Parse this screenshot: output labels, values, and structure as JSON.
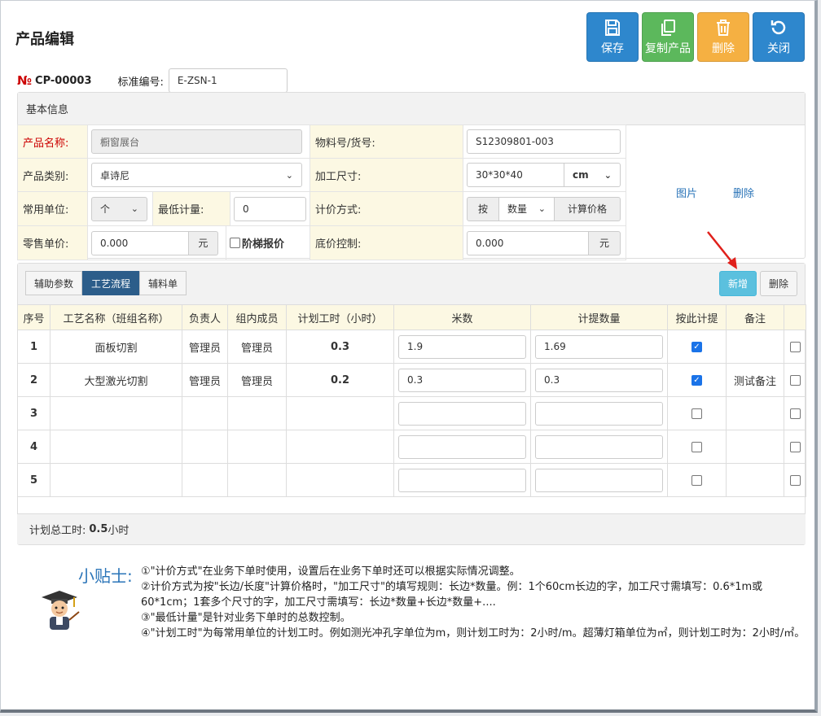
{
  "header": {
    "title": "产品编辑"
  },
  "toolbar": [
    {
      "label": "保存",
      "icon": "save-icon"
    },
    {
      "label": "复制产品",
      "icon": "copy-icon"
    },
    {
      "label": "删除",
      "icon": "trash-icon"
    },
    {
      "label": "关闭",
      "icon": "refresh-icon"
    }
  ],
  "product": {
    "no_mark": "№",
    "code": "CP-00003",
    "std_label": "标准编号:",
    "std_value": "E-ZSN-1"
  },
  "basic": {
    "heading": "基本信息",
    "name_label": "产品名称:",
    "name_value": "橱窗展台",
    "material_label": "物料号/货号:",
    "material_value": "S12309801-003",
    "category_label": "产品类别:",
    "category_value": "卓诗尼",
    "size_label": "加工尺寸:",
    "size_value": "30*30*40",
    "size_unit": "cm",
    "unit_label": "常用单位:",
    "unit_value": "个",
    "min_label": "最低计量:",
    "min_value": "0",
    "pricing_label": "计价方式:",
    "pricing_prefix": "按",
    "pricing_value": "数量",
    "pricing_suffix": "计算价格",
    "retail_label": "零售单价:",
    "retail_value": "0.000",
    "retail_unit": "元",
    "tier_label": "阶梯报价",
    "floor_label": "底价控制:",
    "floor_value": "0.000",
    "floor_unit": "元",
    "image_link": "图片",
    "image_delete": "删除"
  },
  "process": {
    "tabs": [
      "辅助参数",
      "工艺流程",
      "辅料单"
    ],
    "add_button": "新增",
    "delete_button": "删除",
    "columns": [
      "序号",
      "工艺名称（班组名称）",
      "负责人",
      "组内成员",
      "计划工时（小时）",
      "米数",
      "计提数量",
      "按此计提",
      "备注"
    ],
    "rows": [
      {
        "seq": "1",
        "name": "面板切割",
        "owner": "管理员",
        "members": "管理员",
        "hours": "0.3",
        "meters": "1.9",
        "qty": "1.69",
        "by_this": true,
        "note": ""
      },
      {
        "seq": "2",
        "name": "大型激光切割",
        "owner": "管理员",
        "members": "管理员",
        "hours": "0.2",
        "meters": "0.3",
        "qty": "0.3",
        "by_this": true,
        "note": "测试备注"
      },
      {
        "seq": "3",
        "name": "",
        "owner": "",
        "members": "",
        "hours": "",
        "meters": "",
        "qty": "",
        "by_this": false,
        "note": ""
      },
      {
        "seq": "4",
        "name": "",
        "owner": "",
        "members": "",
        "hours": "",
        "meters": "",
        "qty": "",
        "by_this": false,
        "note": ""
      },
      {
        "seq": "5",
        "name": "",
        "owner": "",
        "members": "",
        "hours": "",
        "meters": "",
        "qty": "",
        "by_this": false,
        "note": ""
      }
    ],
    "total_label": "计划总工时:",
    "total_value": "0.5",
    "total_unit": "小时"
  },
  "tips": {
    "title": "小贴士:",
    "lines": [
      "①\"计价方式\"在业务下单时使用，设置后在业务下单时还可以根据实际情况调整。",
      "②计价方式为按\"长边/长度\"计算价格时，\"加工尺寸\"的填写规则：长边*数量。例：1个60cm长边的字，加工尺寸需填写：0.6*1m或60*1cm；1套多个尺寸的字，加工尺寸需填写：长边*数量+长边*数量+....",
      "③\"最低计量\"是针对业务下单时的总数控制。",
      "④\"计划工时\"为每常用单位的计划工时。例如测光冲孔字单位为m，则计划工时为：2小时/m。超薄灯箱单位为㎡，则计划工时为：2小时/㎡。"
    ]
  },
  "colors": {
    "primary": "#2e87cd",
    "success": "#5cb85c",
    "warning": "#f5b042",
    "info": "#5bc0de",
    "label_bg": "#fcf8e3",
    "accent_red": "#cc0000"
  }
}
